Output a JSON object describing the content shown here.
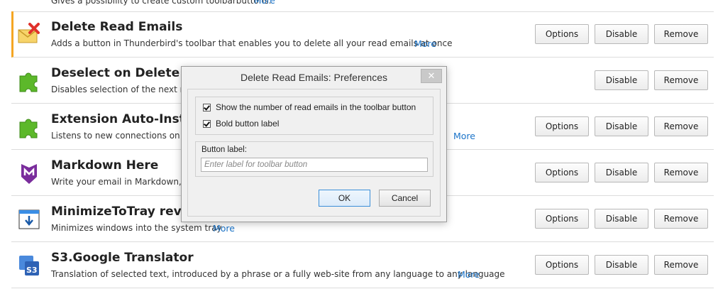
{
  "top_fragment": {
    "text": "Gives a possibility to create custom toolbarbuttons.",
    "more": "More"
  },
  "buttons": {
    "options": "Options",
    "disable": "Disable",
    "remove": "Remove"
  },
  "addons": [
    {
      "name": "Delete Read Emails",
      "description": "Adds a button in Thunderbird's toolbar that enables you to delete all your read emails at once",
      "more": "More",
      "icon": "envelope-delete-icon"
    },
    {
      "name": "Deselect on Delete",
      "description": "Disables selection of the next message",
      "more": "",
      "icon": "puzzle-piece-icon"
    },
    {
      "name": "Extension Auto-Install",
      "description": "Listens to new connections on a port",
      "more": "More",
      "icon": "puzzle-piece-icon"
    },
    {
      "name": "Markdown Here",
      "description": "Write your email in Markdown, then",
      "more": "",
      "icon": "markdown-here-icon"
    },
    {
      "name": "MinimizeToTray revived",
      "description": "Minimizes windows into the system tray",
      "more": "More",
      "icon": "minimize-to-tray-icon"
    },
    {
      "name": "S3.Google Translator",
      "description": "Translation of selected text, introduced by a phrase or a fully web-site from any language to any language",
      "more": "More",
      "icon": "s3-translator-icon"
    }
  ],
  "dialog": {
    "title": "Delete Read Emails: Preferences",
    "close_glyph": "✕",
    "checkbox1": "Show the number of read emails in the toolbar button",
    "checkbox2": "Bold button label",
    "field_label": "Button label:",
    "field_placeholder": "Enter label for toolbar button",
    "ok": "OK",
    "cancel": "Cancel"
  },
  "colors": {
    "accent": "#f5a623",
    "link": "#1a73c8",
    "puzzle": "#5cb82a",
    "markdown": "#7a2d9c"
  }
}
